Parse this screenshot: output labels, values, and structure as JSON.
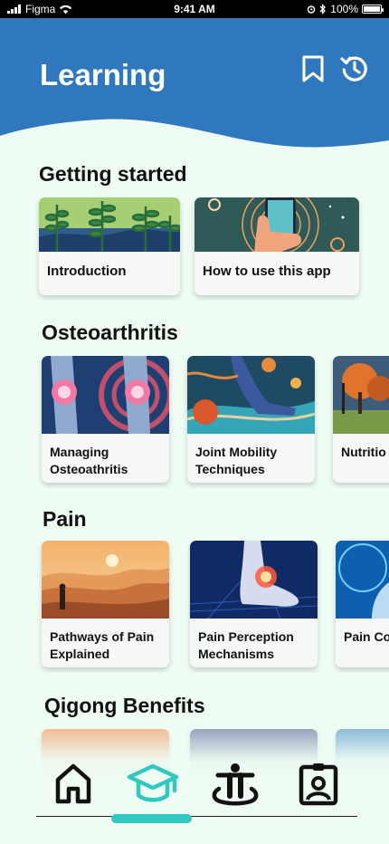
{
  "status_bar": {
    "carrier": "Figma",
    "time": "9:41 AM",
    "battery": "100%"
  },
  "header": {
    "title": "Learning",
    "accent_color": "#2f78bd"
  },
  "sections": [
    {
      "title": "Getting started",
      "items": [
        {
          "label": "Introduction"
        },
        {
          "label": "How to use this app"
        }
      ]
    },
    {
      "title": "Osteoarthritis",
      "items": [
        {
          "label": "Managing Osteoathritis"
        },
        {
          "label": "Joint Mobility Techniques"
        },
        {
          "label": "Nutritio"
        }
      ]
    },
    {
      "title": "Pain",
      "items": [
        {
          "label": "Pathways of Pain Explained"
        },
        {
          "label": "Pain Perception Mechanisms"
        },
        {
          "label": "Pain Co Technic"
        }
      ]
    },
    {
      "title": "Qigong Benefits",
      "items": []
    }
  ],
  "nav": {
    "items": [
      {
        "icon": "home-icon"
      },
      {
        "icon": "graduation-cap-icon",
        "active": true
      },
      {
        "icon": "exercise-icon"
      },
      {
        "icon": "profile-badge-icon"
      }
    ],
    "active_color": "#2fc9c0"
  }
}
